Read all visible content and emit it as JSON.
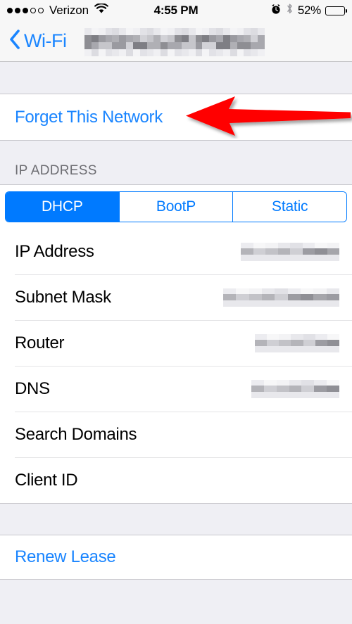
{
  "status_bar": {
    "signal_dots_filled": 3,
    "signal_dots_total": 5,
    "carrier": "Verizon",
    "wifi_icon": "wifi-icon",
    "time": "4:55 PM",
    "alarm_icon": "alarm-clock-icon",
    "bluetooth_icon": "bluetooth-icon",
    "battery_percent_label": "52%",
    "battery_level": 52
  },
  "nav_bar": {
    "back_icon": "chevron-left-icon",
    "back_label": "Wi-Fi",
    "title_redacted": true,
    "title": ""
  },
  "forget_section": {
    "forget_label": "Forget This Network"
  },
  "annotation": {
    "arrow_icon": "left-arrow-annotation",
    "arrow_color": "#FF0000",
    "points_to": "Forget This Network"
  },
  "ip_section": {
    "header": "IP ADDRESS",
    "segments": [
      {
        "label": "DHCP",
        "selected": true
      },
      {
        "label": "BootP",
        "selected": false
      },
      {
        "label": "Static",
        "selected": false
      }
    ],
    "rows": [
      {
        "label": "IP Address",
        "value": "",
        "redacted": true,
        "blur_width": 140
      },
      {
        "label": "Subnet Mask",
        "value": "",
        "redacted": true,
        "blur_width": 165
      },
      {
        "label": "Router",
        "value": "",
        "redacted": true,
        "blur_width": 120
      },
      {
        "label": "DNS",
        "value": "",
        "redacted": true,
        "blur_width": 125
      },
      {
        "label": "Search Domains",
        "value": "",
        "redacted": false,
        "blur_width": 0
      },
      {
        "label": "Client ID",
        "value": "",
        "redacted": false,
        "blur_width": 0
      }
    ]
  },
  "renew_section": {
    "renew_label": "Renew Lease"
  },
  "colors": {
    "accent_blue": "#007AFF",
    "link_blue": "#1A85FF",
    "annotation_red": "#FF0000",
    "group_background": "#EFEFF4",
    "row_background": "#FFFFFF",
    "separator": "#C8C7CC",
    "header_text": "#6D6D72"
  }
}
